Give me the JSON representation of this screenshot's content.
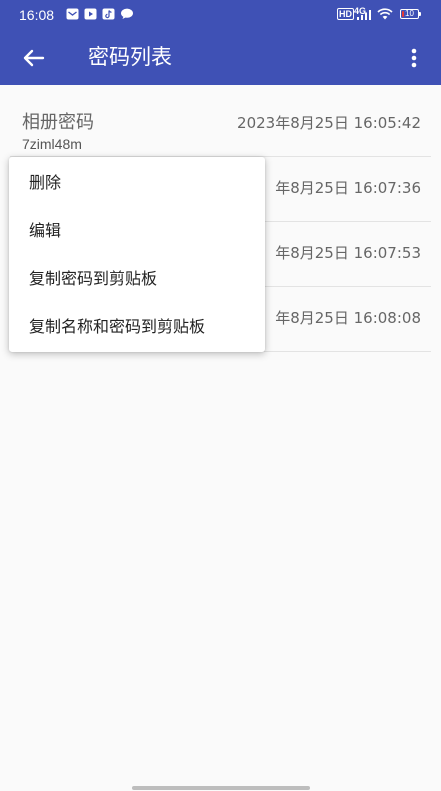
{
  "status_bar": {
    "time": "16:08",
    "notification_icons": [
      "mail-icon",
      "video-icon",
      "tiktok-icon",
      "chat-icon"
    ],
    "hd_label": "HD",
    "network_label": "4G",
    "battery_label": "10",
    "battery_level": 0.1,
    "battery_color": "#e53935"
  },
  "app_bar": {
    "title": "密码列表",
    "back_icon": "arrow-left-icon",
    "more_icon": "more-vert-icon",
    "color": "#3f51b5"
  },
  "list": {
    "items": [
      {
        "name": "相册密码",
        "password": "7ziml48m",
        "time": "2023年8月25日 16:05:42"
      },
      {
        "name": "",
        "password": "",
        "time": "年8月25日 16:07:36"
      },
      {
        "name": "",
        "password": "",
        "time": "年8月25日 16:07:53"
      },
      {
        "name": "",
        "password": "",
        "time": "年8月25日 16:08:08"
      }
    ]
  },
  "context_menu": {
    "items": [
      {
        "label": "删除"
      },
      {
        "label": "编辑"
      },
      {
        "label": "复制密码到剪贴板"
      },
      {
        "label": "复制名称和密码到剪贴板"
      }
    ]
  }
}
